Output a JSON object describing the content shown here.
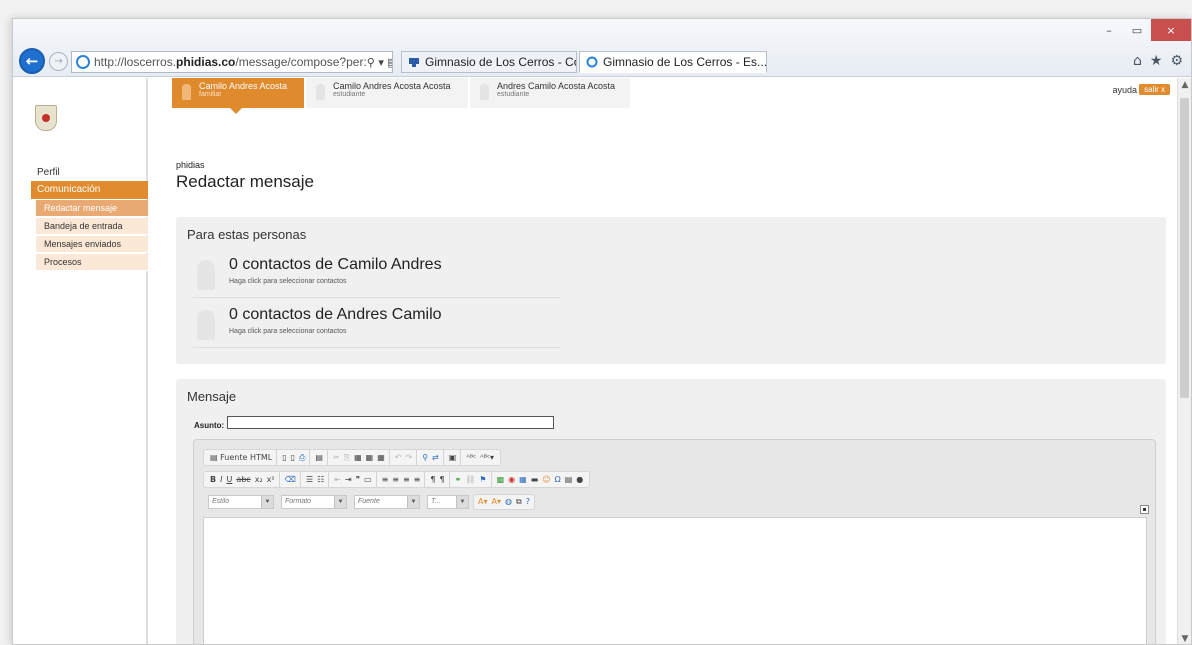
{
  "window": {
    "controls": [
      "–",
      "▭",
      "×"
    ]
  },
  "browser": {
    "back_glyph": "←",
    "forward_glyph": "→",
    "address_prefix": "http://loscerros.",
    "address_domain": "phidias.co",
    "address_path": "/message/compose?per:",
    "address_controls": "⚲ ▾ ▤ ↻",
    "tabs": [
      {
        "title": "Gimnasio de Los Cerros - Cole...",
        "active": false
      },
      {
        "title": "Gimnasio de Los Cerros - Es...",
        "active": true,
        "close": "×"
      }
    ],
    "right_icons": [
      "⌂",
      "★",
      "⚙"
    ]
  },
  "header": {
    "help": "ayuda",
    "logout": "salir x"
  },
  "student_tabs": [
    {
      "name": "Camilo Andres Acosta",
      "role": "familiar",
      "active": true
    },
    {
      "name": "Camilo Andres Acosta Acosta",
      "role": "estudiante",
      "active": false
    },
    {
      "name": "Andres Camilo Acosta Acosta",
      "role": "estudiante",
      "active": false
    }
  ],
  "sidebar": {
    "perfil": "Perfil",
    "section": "Comunicación",
    "items": [
      {
        "label": "Redactar mensaje",
        "active": true
      },
      {
        "label": "Bandeja de entrada",
        "active": false
      },
      {
        "label": "Mensajes enviados",
        "active": false
      },
      {
        "label": "Procesos",
        "active": false
      }
    ]
  },
  "main": {
    "breadcrumb": "phidias",
    "title": "Redactar mensaje",
    "recipients": {
      "heading": "Para estas personas",
      "contacts": [
        {
          "title": "0 contactos de Camilo Andres",
          "subtitle": "Haga click para seleccionar contactos"
        },
        {
          "title": "0 contactos de Andres Camilo",
          "subtitle": "Haga click para seleccionar contactos"
        }
      ]
    },
    "message": {
      "heading": "Mensaje",
      "subject_label": "Asunto:",
      "subject_value": ""
    },
    "editor": {
      "source_label": "Fuente HTML",
      "toolbar1": [
        "▯",
        "▯",
        "⎙",
        "▤",
        "✂",
        "⎘",
        "▦",
        "▦",
        "▦",
        "↶",
        "↷",
        "⚲",
        "⇄",
        "▣",
        "ᴬᴮᶜ",
        "ᴬᴮᶜ▾"
      ],
      "toolbar2": [
        "B",
        "I",
        "U",
        "abc",
        "x₂",
        "x²",
        "⌫",
        "☰",
        "☷",
        "⇤",
        "⇥",
        "❞",
        "▭",
        "≡",
        "≡",
        "≡",
        "≡",
        "¶",
        "¶",
        "⚭",
        "⛓",
        "⚑",
        "▩",
        "◉",
        "▦",
        "▬",
        "☺",
        "Ω",
        "▤",
        "●"
      ],
      "style_combo": "Estilo",
      "format_combo": "Formato",
      "font_combo": "Fuente",
      "size_combo": "T...",
      "toolbar3": [
        "A▾",
        "A▾",
        "◍",
        "⧉",
        "?"
      ],
      "collapse": "▪"
    }
  },
  "colors": {
    "accent": "#e08b2d",
    "panel": "#f0f0f0"
  }
}
